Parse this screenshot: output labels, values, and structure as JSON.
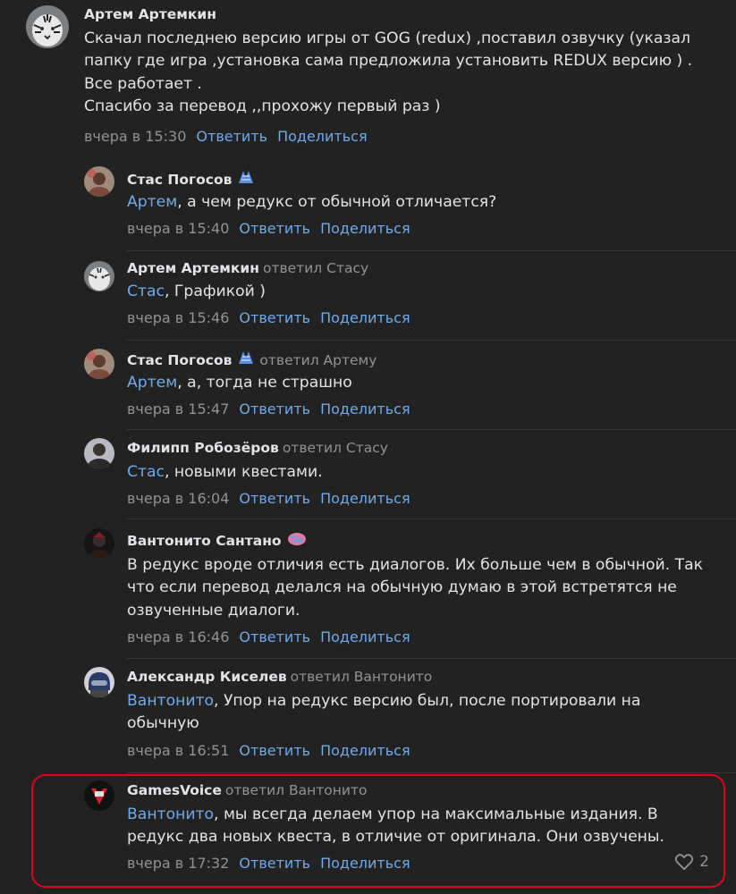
{
  "comments": [
    {
      "author": "Артем Артемкин",
      "replied_to": "",
      "lines": [
        "Скачал последнею версию игры от GOG (redux) ,поставил озвучку (указал",
        "папку где игра ,установка сама предложила установить REDUX версию ) .",
        "Все работает .",
        "Спасибо за перевод ,,прохожу первый раз )"
      ],
      "time": "вчера в 15:30",
      "reply_label": "Ответить",
      "share_label": "Поделиться"
    },
    {
      "author": "Стас Погосов",
      "replied_to": "",
      "mention": "Артем",
      "lines": [
        ", а чем редукс от обычной отличается?"
      ],
      "time": "вчера в 15:40",
      "reply_label": "Ответить",
      "share_label": "Поделиться"
    },
    {
      "author": "Артем Артемкин",
      "replied_to": "ответил Стасу",
      "mention": "Стас",
      "lines": [
        ", Графикой )"
      ],
      "time": "вчера в 15:46",
      "reply_label": "Ответить",
      "share_label": "Поделиться"
    },
    {
      "author": "Стас Погосов",
      "replied_to": "ответил Артему",
      "mention": "Артем",
      "lines": [
        ", а, тогда не страшно"
      ],
      "time": "вчера в 15:47",
      "reply_label": "Ответить",
      "share_label": "Поделиться"
    },
    {
      "author": "Филипп Робозёров",
      "replied_to": "ответил Стасу",
      "mention": "Стас",
      "lines": [
        ", новыми квестами."
      ],
      "time": "вчера в 16:04",
      "reply_label": "Ответить",
      "share_label": "Поделиться"
    },
    {
      "author": "Вантонито Сантано",
      "replied_to": "",
      "lines": [
        "В редукс вроде отличия есть диалогов. Их больше чем в обычной. Так",
        "что если перевод делался на обычную думаю в этой встретятся не",
        "озвученные диалоги."
      ],
      "time": "вчера в 16:46",
      "reply_label": "Ответить",
      "share_label": "Поделиться"
    },
    {
      "author": "Александр Киселев",
      "replied_to": "ответил Вантонито",
      "mention": "Вантонито",
      "lines": [
        ", Упор на редукс версию был, после портировали на",
        "обычную"
      ],
      "time": "вчера в 16:51",
      "reply_label": "Ответить",
      "share_label": "Поделиться"
    },
    {
      "author": "GamesVoice",
      "replied_to": "ответил Вантонито",
      "mention": "Вантонито",
      "lines": [
        ", мы всегда делаем упор на максимальные издания. В",
        "редукс два новых квеста, в отличие от оригинала. Они озвучены."
      ],
      "time": "вчера в 17:32",
      "reply_label": "Ответить",
      "share_label": "Поделиться",
      "likes": "2"
    }
  ],
  "colors": {
    "background": "#222222",
    "link": "#71aaeb",
    "muted": "#939393",
    "text": "#e1e3e6",
    "highlight": "#e0001a"
  }
}
